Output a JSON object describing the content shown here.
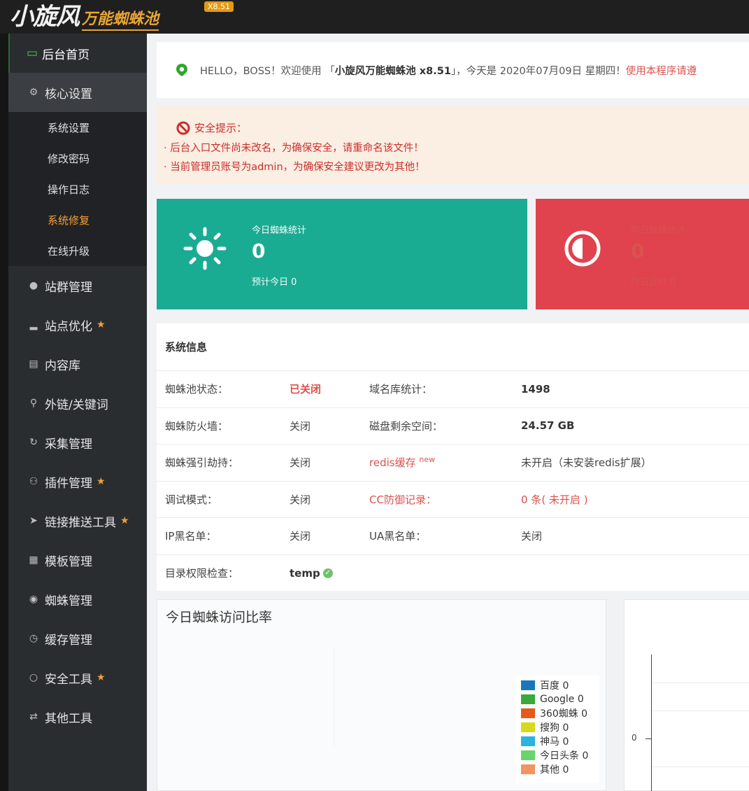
{
  "header": {
    "logo_main": "小旋风",
    "logo_sub": "万能蜘蛛池",
    "version": "X8.51"
  },
  "sidebar": {
    "home": "后台首页",
    "core": "核心设置",
    "sub_items": [
      "系统设置",
      "修改密码",
      "操作日志",
      "系统修复",
      "在线升级"
    ],
    "items": [
      {
        "label": "站群管理",
        "icon": "user-icon",
        "pinned": false
      },
      {
        "label": "站点优化",
        "icon": "bar-chart-icon",
        "pinned": true
      },
      {
        "label": "内容库",
        "icon": "document-icon",
        "pinned": false
      },
      {
        "label": "外链/关键词",
        "icon": "key-icon",
        "pinned": false
      },
      {
        "label": "采集管理",
        "icon": "refresh-icon",
        "pinned": false
      },
      {
        "label": "插件管理",
        "icon": "plug-icon",
        "pinned": true
      },
      {
        "label": "链接推送工具",
        "icon": "send-icon",
        "pinned": true
      },
      {
        "label": "模板管理",
        "icon": "windows-icon",
        "pinned": false
      },
      {
        "label": "蜘蛛管理",
        "icon": "android-icon",
        "pinned": false
      },
      {
        "label": "缓存管理",
        "icon": "timer-icon",
        "pinned": false
      },
      {
        "label": "安全工具",
        "icon": "bulb-icon",
        "pinned": true
      },
      {
        "label": "其他工具",
        "icon": "shuffle-icon",
        "pinned": false
      }
    ]
  },
  "welcome": {
    "prefix": "HELLO，BOSS！欢迎使用 「",
    "product": "小旋风万能蜘蛛池 x8.51",
    "middle": "」，今天是 2020年07月09日 星期四！",
    "notice": "使用本程序请遵"
  },
  "alert": {
    "title": "安全提示：",
    "lines": [
      "· 后台入口文件尚未改名，为确保安全，请重命名该文件！",
      "· 当前管理员账号为admin，为确保安全建议更改为其他！"
    ]
  },
  "cards": {
    "today": {
      "label": "今日蜘蛛统计",
      "value": "0",
      "sub": "预计今日 0",
      "color": "#1aab93"
    },
    "yesterday": {
      "label": "昨日蜘蛛统计",
      "value": "0",
      "sub": "昨日此时 0",
      "color": "#e0424e"
    }
  },
  "sysinfo": {
    "title": "系统信息",
    "rows": [
      [
        "蜘蛛池状态：",
        "已关闭",
        "域名库统计：",
        "1498"
      ],
      [
        "蜘蛛防火墙：",
        "关闭",
        "磁盘剩余空间：",
        "24.57 GB"
      ],
      [
        "蜘蛛强引劫持：",
        "关闭",
        "redis缓存",
        "未开启（未安装redis扩展）"
      ],
      [
        "调试模式：",
        "关闭",
        "CC防御记录：",
        "0 条"
      ],
      [
        "IP黑名单：",
        "关闭",
        "UA黑名单：",
        "关闭"
      ],
      [
        "目录权限检查：",
        "temp",
        "",
        ""
      ]
    ],
    "new_badge": "new",
    "cc_status": "( 未开启 )"
  },
  "pie": {
    "title": "今日蜘蛛访问比率",
    "legend": [
      {
        "label": "百度 0",
        "color": "#1a77bd"
      },
      {
        "label": "Google 0",
        "color": "#3aa93a"
      },
      {
        "label": "360蜘蛛 0",
        "color": "#e55a1a"
      },
      {
        "label": "搜狗 0",
        "color": "#d8d81c"
      },
      {
        "label": "神马 0",
        "color": "#2bb4e0"
      },
      {
        "label": "今日头条 0",
        "color": "#6ad46a"
      },
      {
        "label": "其他 0",
        "color": "#f2945e"
      }
    ]
  },
  "line": {
    "zero": "0"
  }
}
